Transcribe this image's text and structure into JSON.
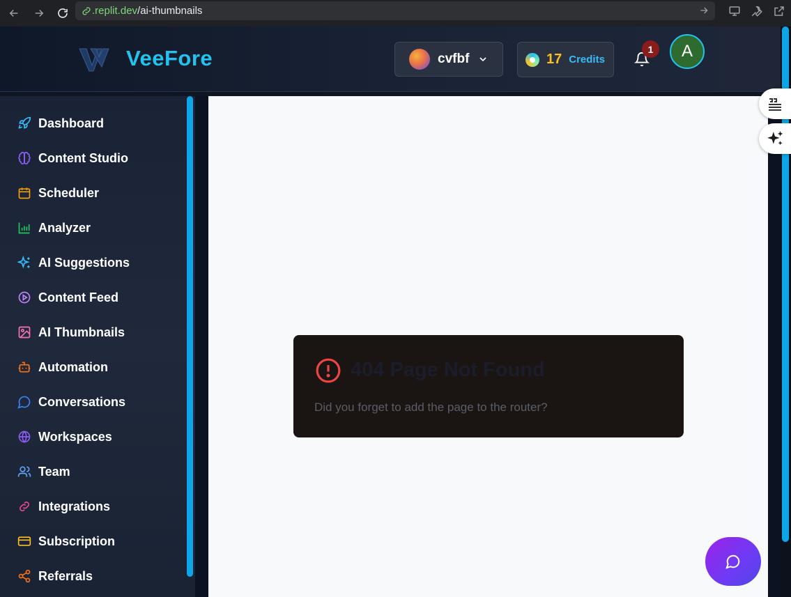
{
  "browser": {
    "url_host_prefix": "",
    "url_host": ".replit.dev",
    "url_path": "/ai-thumbnails"
  },
  "header": {
    "logo_text": "VeeFore",
    "workspace_name": "cvfbf",
    "credits_value": "17",
    "credits_label": "Credits",
    "notification_count": "1",
    "user_initial": "A"
  },
  "sidebar": {
    "items": [
      {
        "label": "Dashboard",
        "icon": "rocket-icon",
        "color": "#38bdf8"
      },
      {
        "label": "Content Studio",
        "icon": "brain-icon",
        "color": "#8b5cf6"
      },
      {
        "label": "Scheduler",
        "icon": "calendar-icon",
        "color": "#f59e0b"
      },
      {
        "label": "Analyzer",
        "icon": "bar-chart-icon",
        "color": "#22c55e"
      },
      {
        "label": "AI Suggestions",
        "icon": "sparkles-icon",
        "color": "#38bdf8"
      },
      {
        "label": "Content Feed",
        "icon": "play-circle-icon",
        "color": "#c084fc"
      },
      {
        "label": "AI Thumbnails",
        "icon": "image-icon",
        "color": "#f472b6"
      },
      {
        "label": "Automation",
        "icon": "bot-icon",
        "color": "#f97316"
      },
      {
        "label": "Conversations",
        "icon": "message-circle-icon",
        "color": "#3b82f6"
      },
      {
        "label": "Workspaces",
        "icon": "globe-icon",
        "color": "#8b5cf6"
      },
      {
        "label": "Team",
        "icon": "users-icon",
        "color": "#60a5fa"
      },
      {
        "label": "Integrations",
        "icon": "link-icon",
        "color": "#ec4899"
      },
      {
        "label": "Subscription",
        "icon": "credit-card-icon",
        "color": "#fbbf24"
      },
      {
        "label": "Referrals",
        "icon": "share-icon",
        "color": "#f97316"
      }
    ]
  },
  "main": {
    "error_title": "404 Page Not Found",
    "error_message": "Did you forget to add the page to the router?"
  }
}
